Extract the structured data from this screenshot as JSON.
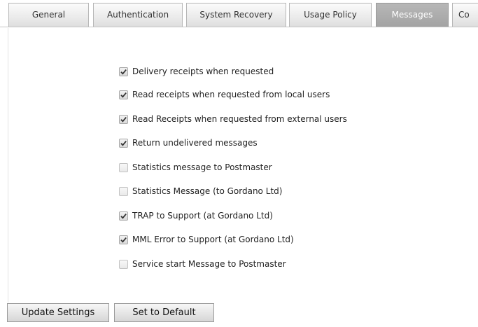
{
  "tabs": [
    {
      "label": "General",
      "active": false
    },
    {
      "label": "Authentication",
      "active": false
    },
    {
      "label": "System Recovery",
      "active": false
    },
    {
      "label": "Usage Policy",
      "active": false
    },
    {
      "label": "Messages",
      "active": true
    },
    {
      "label": "Co",
      "active": false
    }
  ],
  "options": [
    {
      "label": "Delivery receipts when requested",
      "checked": true
    },
    {
      "label": "Read receipts when requested from local users",
      "checked": true
    },
    {
      "label": "Read Receipts when requested from external users",
      "checked": true
    },
    {
      "label": "Return undelivered messages",
      "checked": true
    },
    {
      "label": "Statistics message to Postmaster",
      "checked": false
    },
    {
      "label": "Statistics Message (to Gordano Ltd)",
      "checked": false
    },
    {
      "label": "TRAP to Support (at Gordano Ltd)",
      "checked": true
    },
    {
      "label": "MML Error to Support (at Gordano Ltd)",
      "checked": true
    },
    {
      "label": "Service start Message to Postmaster",
      "checked": false
    }
  ],
  "buttons": {
    "update": "Update Settings",
    "default": "Set to Default"
  }
}
